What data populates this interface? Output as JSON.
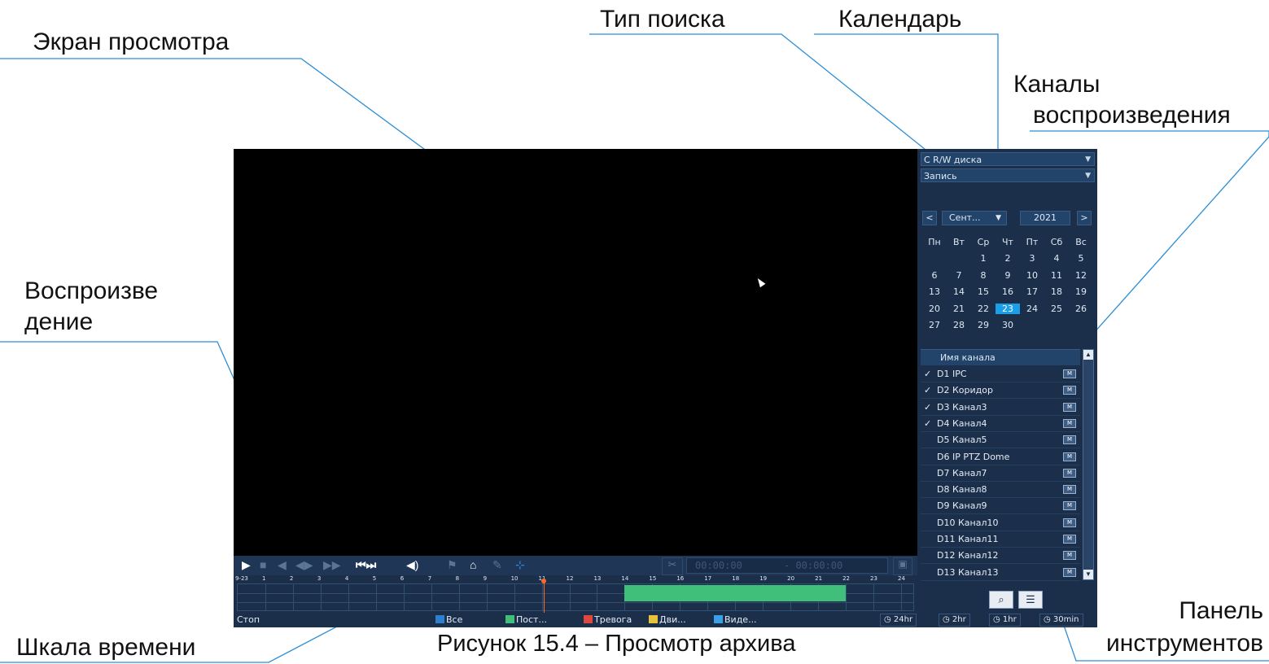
{
  "annotations": {
    "view_screen": "Экран просмотра",
    "search_type": "Тип поиска",
    "calendar": "Календарь",
    "channels_line1": "Каналы",
    "channels_line2": "воспроизведения",
    "playback_line1": "Воспроизве",
    "playback_line2": "дение",
    "timeline": "Шкала времени",
    "toolbar_line1": "Панель",
    "toolbar_line2": "инструментов",
    "caption": "Рисунок 15.4 – Просмотр архива",
    "accent_color": "#1a9ee8"
  },
  "sidebar": {
    "source_select": "С R/W диска",
    "record_type_select": "Запись",
    "calendar": {
      "prev": "<",
      "month": "Сент...",
      "year": "2021",
      "next": ">",
      "weekdays": [
        "Пн",
        "Вт",
        "Ср",
        "Чт",
        "Пт",
        "Сб",
        "Вс"
      ],
      "weeks": [
        [
          "",
          "",
          "1",
          "2",
          "3",
          "4",
          "5"
        ],
        [
          "6",
          "7",
          "8",
          "9",
          "10",
          "11",
          "12"
        ],
        [
          "13",
          "14",
          "15",
          "16",
          "17",
          "18",
          "19"
        ],
        [
          "20",
          "21",
          "22",
          "23",
          "24",
          "25",
          "26"
        ],
        [
          "27",
          "28",
          "29",
          "30",
          "",
          "",
          ""
        ]
      ],
      "selected_day": "23"
    },
    "channel_header": "Имя канала",
    "channels": [
      {
        "name": "D1 IPC",
        "checked": true
      },
      {
        "name": "D2 Коридор",
        "checked": true
      },
      {
        "name": "D3 Канал3",
        "checked": true
      },
      {
        "name": "D4 Канал4",
        "checked": true
      },
      {
        "name": "D5 Канал5",
        "checked": false
      },
      {
        "name": "D6 IP PTZ Dome",
        "checked": false
      },
      {
        "name": "D7 Канал7",
        "checked": false
      },
      {
        "name": "D8 Канал8",
        "checked": false
      },
      {
        "name": "D9 Канал9",
        "checked": false
      },
      {
        "name": "D10 Канал10",
        "checked": false
      },
      {
        "name": "D11 Канал11",
        "checked": false
      },
      {
        "name": "D12 Канал12",
        "checked": false
      },
      {
        "name": "D13 Канал13",
        "checked": false
      }
    ],
    "m_label": "M"
  },
  "controls": {
    "time_start": "00:00:00",
    "time_end": "- 00:00:00"
  },
  "timeline": {
    "date": "9-23",
    "hours": [
      "1",
      "2",
      "3",
      "4",
      "5",
      "6",
      "7",
      "8",
      "9",
      "10",
      "11",
      "12",
      "13",
      "14",
      "15",
      "16",
      "17",
      "18",
      "19",
      "20",
      "21",
      "22",
      "23",
      "24"
    ],
    "record_segments": [
      [
        14.0,
        22.0
      ]
    ],
    "current_hour": 11.0
  },
  "status": {
    "state": "Стоп",
    "legend": [
      {
        "label": "Все",
        "color": "#2f7fd0"
      },
      {
        "label": "Пост...",
        "color": "#3fbf7a"
      },
      {
        "label": "Тревога",
        "color": "#e0483e"
      },
      {
        "label": "Дви...",
        "color": "#e8c23a"
      },
      {
        "label": "Виде...",
        "color": "#3aa0e8"
      }
    ],
    "zoom": [
      "24hr",
      "2hr",
      "1hr",
      "30min"
    ]
  }
}
